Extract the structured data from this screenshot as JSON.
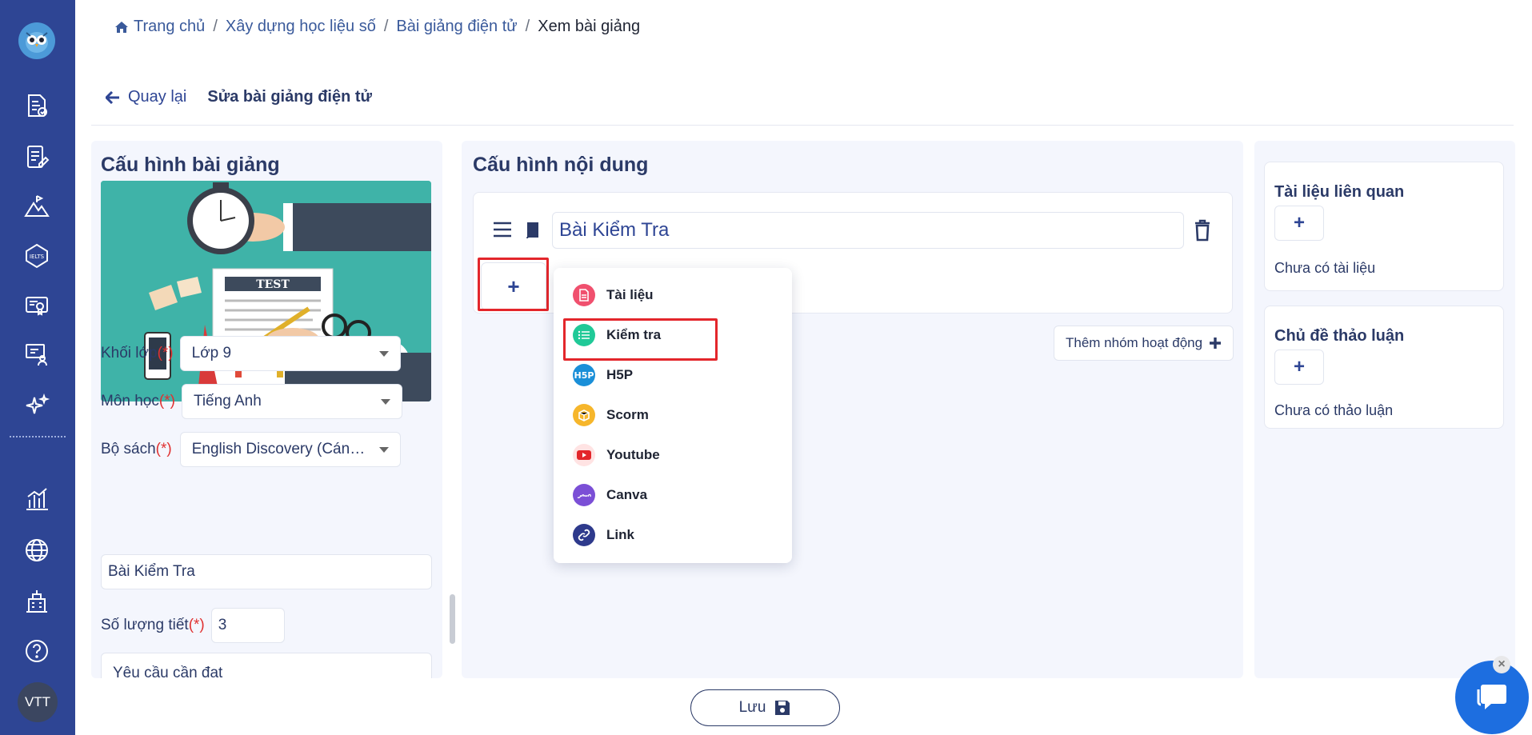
{
  "sidebar": {
    "items": [
      {
        "icon": "lesson-document-icon"
      },
      {
        "icon": "edit-document-icon"
      },
      {
        "icon": "mountain-chart-icon"
      },
      {
        "icon": "ielts-badge-icon"
      },
      {
        "icon": "certificate-icon"
      },
      {
        "icon": "teacher-board-icon"
      },
      {
        "icon": "sparkle-ai-icon"
      },
      {
        "icon": "statistics-chart-icon"
      },
      {
        "icon": "globe-icon"
      },
      {
        "icon": "school-building-icon"
      },
      {
        "icon": "help-circle-icon"
      }
    ],
    "avatar_initials": "VTT"
  },
  "breadcrumb": {
    "home": "Trang chủ",
    "level1": "Xây dựng học liệu số",
    "level2": "Bài giảng điện tử",
    "current": "Xem bài giảng",
    "separator": "/"
  },
  "header": {
    "back_label": "Quay lại",
    "edit_title": "Sửa bài giảng điện tử"
  },
  "left_panel": {
    "title": "Cấu hình bài giảng",
    "cover_text": "TEST",
    "grade": {
      "label": "Khối lớp",
      "required": "(*)",
      "value": "Lớp 9"
    },
    "subject": {
      "label": "Môn học",
      "required": "(*)",
      "value": "Tiếng Anh"
    },
    "book": {
      "label": "Bộ sách",
      "required": "(*)",
      "value": "English Discovery (Cánh Buồm)"
    },
    "lesson_name": "Bài Kiểm Tra",
    "periods": {
      "label": "Số lượng tiết",
      "required": "(*)",
      "value": "3"
    },
    "requirements_placeholder": "Yêu cầu cần đạt"
  },
  "middle_panel": {
    "title": "Cấu hình nội dung",
    "activity_title": "Bài Kiểm Tra",
    "add_symbol": "+",
    "add_group_label": "Thêm nhóm hoạt động",
    "menu": [
      {
        "label": "Tài liệu",
        "icon": "document-icon",
        "color": "#f0506e"
      },
      {
        "label": "Kiểm tra",
        "icon": "test-list-icon",
        "color": "#20c997"
      },
      {
        "label": "H5P",
        "icon": "h5p-icon",
        "color": "#1a8fd8"
      },
      {
        "label": "Scorm",
        "icon": "scorm-box-icon",
        "color": "#f6b62b"
      },
      {
        "label": "Youtube",
        "icon": "youtube-icon",
        "color": "#e3262b"
      },
      {
        "label": "Canva",
        "icon": "canva-icon",
        "color": "#7b4fd6"
      },
      {
        "label": "Link",
        "icon": "link-icon",
        "color": "#2e3a8c"
      }
    ]
  },
  "right_panel": {
    "related_title": "Tài liệu liên quan",
    "related_empty": "Chưa có tài liệu",
    "discussion_title": "Chủ đề thảo luận",
    "discussion_empty": "Chưa có thảo luận",
    "add_symbol": "+"
  },
  "footer": {
    "save_label": "Lưu"
  },
  "chat": {
    "close_symbol": "×"
  },
  "colors": {
    "sidebar": "#2e4594",
    "highlight": "#e3262b",
    "primary_text": "#2b3a67"
  }
}
